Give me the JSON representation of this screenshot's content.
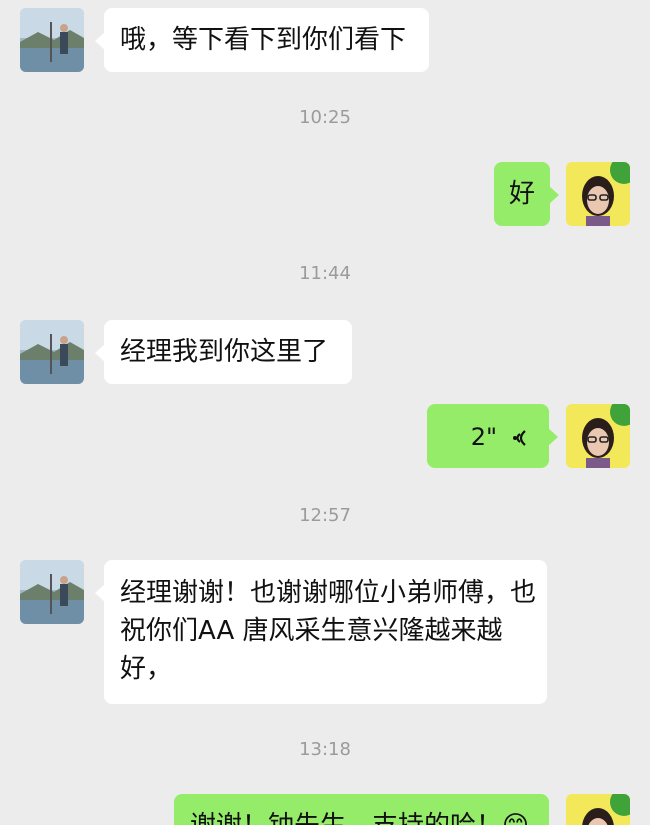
{
  "messages": [
    {
      "text": "哦，等下看下到你们看下"
    },
    {
      "time": "10:25"
    },
    {
      "text": "好"
    },
    {
      "time": "11:44"
    },
    {
      "text": "经理我到你这里了"
    },
    {
      "voice_duration": "2\""
    },
    {
      "time": "12:57"
    },
    {
      "text_lines": [
        "经理谢谢！也谢谢哪位小弟师傅，也",
        "祝你们AA 唐风采生意兴隆越来越",
        "好，"
      ]
    },
    {
      "time": "13:18"
    },
    {
      "text": "谢谢！钟先生，支持的哈！😊"
    }
  ],
  "colors": {
    "background": "#ececec",
    "incoming_bubble": "#ffffff",
    "outgoing_bubble": "#95ec69",
    "timestamp": "#9b9b9b"
  },
  "icons": {
    "contact_avatar": "man-standing-by-lake-avatar",
    "my_avatar": "woman-with-glasses-avatar",
    "voice": "voice-wave-icon"
  }
}
